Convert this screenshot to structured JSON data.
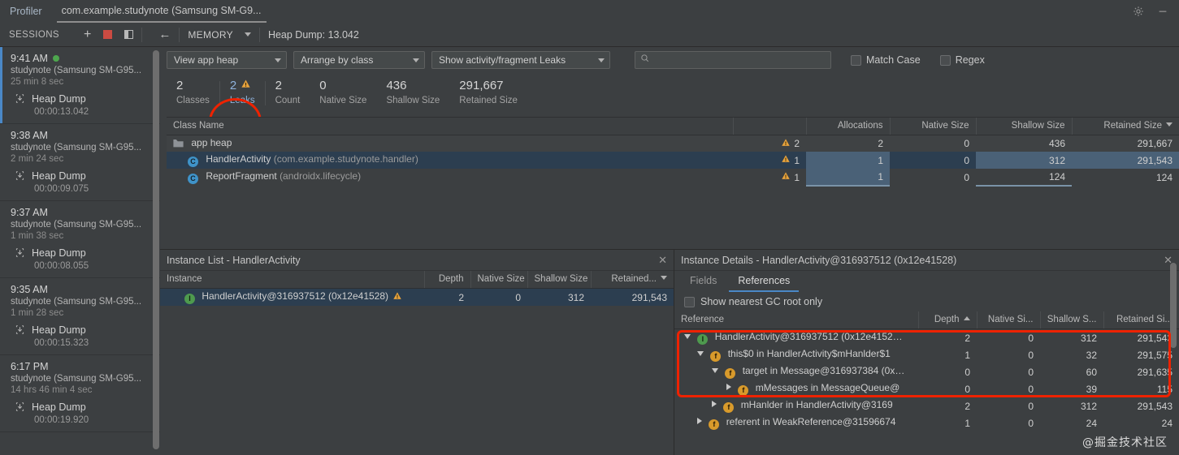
{
  "titlebar": {
    "tool_label": "Profiler",
    "active_tab": "com.example.studynote (Samsung SM-G9...",
    "settings_icon": "gear-icon",
    "minimize_icon": "minimize-icon"
  },
  "subbar": {
    "sessions_label": "SESSIONS",
    "add_icon": "plus-icon",
    "stop_icon": "stop-square-icon",
    "split_icon": "split-pane-icon",
    "back_icon": "back-arrow-icon",
    "stage_label": "MEMORY",
    "stage_caret": "chevron-down-icon",
    "heap_dump_label": "Heap Dump: 13.042"
  },
  "sessions": [
    {
      "time": "9:41 AM",
      "live": true,
      "device": "studynote (Samsung SM-G95...",
      "duration": "25 min 8 sec",
      "dump_label": "Heap Dump",
      "dump_time": "00:00:13.042",
      "selected": true
    },
    {
      "time": "9:38 AM",
      "live": false,
      "device": "studynote (Samsung SM-G95...",
      "duration": "2 min 24 sec",
      "dump_label": "Heap Dump",
      "dump_time": "00:00:09.075",
      "selected": false
    },
    {
      "time": "9:37 AM",
      "live": false,
      "device": "studynote (Samsung SM-G95...",
      "duration": "1 min 38 sec",
      "dump_label": "Heap Dump",
      "dump_time": "00:00:08.055",
      "selected": false
    },
    {
      "time": "9:35 AM",
      "live": false,
      "device": "studynote (Samsung SM-G95...",
      "duration": "1 min 28 sec",
      "dump_label": "Heap Dump",
      "dump_time": "00:00:15.323",
      "selected": false
    },
    {
      "time": "6:17 PM",
      "live": false,
      "device": "studynote (Samsung SM-G95...",
      "duration": "14 hrs 46 min 4 sec",
      "dump_label": "Heap Dump",
      "dump_time": "00:00:19.920",
      "selected": false
    }
  ],
  "filters": {
    "heap_select": "View app heap",
    "arrange_select": "Arrange by class",
    "leaks_select": "Show activity/fragment Leaks",
    "search_value": "",
    "search_placeholder": "",
    "search_icon": "search-icon",
    "match_case_label": "Match Case",
    "match_case_checked": false,
    "regex_label": "Regex",
    "regex_checked": false
  },
  "stats": [
    {
      "value": "2",
      "name": "Classes",
      "warn": false
    },
    {
      "value": "2",
      "name": "Leaks",
      "warn": true,
      "highlight": true
    },
    {
      "value": "2",
      "name": "Count",
      "warn": false
    },
    {
      "value": "0",
      "name": "Native Size",
      "warn": false
    },
    {
      "value": "436",
      "name": "Shallow Size",
      "warn": false
    },
    {
      "value": "291,667",
      "name": "Retained Size",
      "warn": false
    }
  ],
  "annotations": {
    "leaks_ellipse_color": "#ee2200",
    "references_rect_color": "#ee2200"
  },
  "class_table": {
    "columns": [
      "Class Name",
      "",
      "Allocations",
      "Native Size",
      "Shallow Size",
      "Retained Size"
    ],
    "sorted_column": "Retained Size",
    "sort_direction": "desc",
    "rows": [
      {
        "icon": "folder-icon",
        "name": "app heap",
        "package": "",
        "leaks": "2",
        "allocations": "2",
        "native": "0",
        "shallow": "436",
        "retained": "291,667",
        "kind": "heap",
        "selected": false
      },
      {
        "icon": "class-icon",
        "name": "HandlerActivity",
        "package": "(com.example.studynote.handler)",
        "leaks": "1",
        "allocations": "1",
        "native": "0",
        "shallow": "312",
        "retained": "291,543",
        "kind": "class",
        "selected": true
      },
      {
        "icon": "class-icon",
        "name": "ReportFragment",
        "package": "(androidx.lifecycle)",
        "leaks": "1",
        "allocations": "1",
        "native": "0",
        "shallow": "124",
        "retained": "124",
        "kind": "class",
        "selected": false
      }
    ]
  },
  "instance_list": {
    "title": "Instance List - HandlerActivity",
    "close_icon": "close-icon",
    "columns": [
      "Instance",
      "Depth",
      "Native Size",
      "Shallow Size",
      "Retained..."
    ],
    "sorted_column": "Retained...",
    "sort_direction": "desc",
    "rows": [
      {
        "icon": "instance-icon",
        "name": "HandlerActivity@316937512 (0x12e41528)",
        "warn": true,
        "depth": "2",
        "native": "0",
        "shallow": "312",
        "retained": "291,543",
        "selected": true
      }
    ]
  },
  "instance_details": {
    "title": "Instance Details - HandlerActivity@316937512 (0x12e41528)",
    "close_icon": "close-icon",
    "tabs": [
      {
        "label": "Fields",
        "active": false
      },
      {
        "label": "References",
        "active": true
      }
    ],
    "gc_root_label": "Show nearest GC root only",
    "gc_root_checked": false,
    "columns": [
      "Reference",
      "Depth",
      "Native Si...",
      "Shallow S...",
      "Retained Si..."
    ],
    "sorted_column": "Depth",
    "sort_direction": "asc",
    "rows": [
      {
        "indent": 0,
        "expander": "down",
        "icon": "instance-icon",
        "label": "HandlerActivity@316937512 (0x12e4152…",
        "depth": "2",
        "native": "0",
        "shallow": "312",
        "retained": "291,543"
      },
      {
        "indent": 1,
        "expander": "down",
        "icon": "field-icon",
        "label": "this$0 in HandlerActivity$mHanlder$1",
        "depth": "1",
        "native": "0",
        "shallow": "32",
        "retained": "291,575"
      },
      {
        "indent": 2,
        "expander": "down",
        "icon": "field-icon",
        "label": "target in Message@316937384 (0x…",
        "depth": "0",
        "native": "0",
        "shallow": "60",
        "retained": "291,635"
      },
      {
        "indent": 3,
        "expander": "right",
        "icon": "field-icon",
        "label": "mMessages in MessageQueue@",
        "depth": "0",
        "native": "0",
        "shallow": "39",
        "retained": "115"
      },
      {
        "indent": 2,
        "expander": "right",
        "icon": "field-icon",
        "label": "mHanlder in HandlerActivity@3169",
        "depth": "2",
        "native": "0",
        "shallow": "312",
        "retained": "291,543"
      },
      {
        "indent": 1,
        "expander": "right",
        "icon": "field-icon",
        "label": "referent in WeakReference@31596674",
        "depth": "1",
        "native": "0",
        "shallow": "24",
        "retained": "24"
      }
    ]
  },
  "watermark": "@掘金技术社区"
}
